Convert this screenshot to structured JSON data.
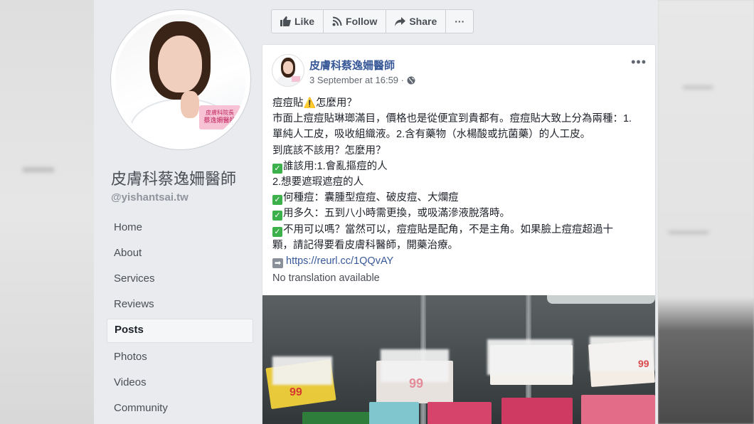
{
  "page": {
    "name": "皮膚科蔡逸姍醫師",
    "handle": "@yishantsai.tw",
    "avatar_badge_lines": [
      "皮膚科院長",
      "蔡逸姍醫師"
    ]
  },
  "nav": {
    "items": [
      {
        "label": "Home",
        "active": false
      },
      {
        "label": "About",
        "active": false
      },
      {
        "label": "Services",
        "active": false
      },
      {
        "label": "Reviews",
        "active": false
      },
      {
        "label": "Posts",
        "active": true
      },
      {
        "label": "Photos",
        "active": false
      },
      {
        "label": "Videos",
        "active": false
      },
      {
        "label": "Community",
        "active": false
      }
    ]
  },
  "actions": {
    "like": "Like",
    "follow": "Follow",
    "share": "Share",
    "more": "···"
  },
  "post": {
    "author": "皮膚科蔡逸姍醫師",
    "timestamp": "3 September at 16:59 ·",
    "more": "•••",
    "lines": [
      {
        "prefix": "",
        "text": "痘痘貼",
        "warn": "⚠️",
        "after": "怎麼用？"
      },
      {
        "prefix": "",
        "text": "市面上痘痘貼琳瑯滿目，價格也是從便宜到貴都有。痘痘貼大致上分為兩種：1."
      },
      {
        "prefix": "",
        "text": "單純人工皮，吸收組織液。2.含有藥物（水楊酸或抗菌藥）的人工皮。"
      },
      {
        "prefix": "",
        "text": "到底該不該用？怎麼用？"
      },
      {
        "prefix": "check",
        "text": "誰該用:1.會亂摳痘的人"
      },
      {
        "prefix": "",
        "text": "2.想要遮瑕遮痘的人"
      },
      {
        "prefix": "check",
        "text": "何種痘：囊腫型痘痘、破皮痘、大爛痘"
      },
      {
        "prefix": "check",
        "text": "用多久：五到八小時需更換，或吸滿滲液脫落時。"
      },
      {
        "prefix": "check",
        "text": "不用可以嗎？當然可以，痘痘貼是配角，不是主角。如果臉上痘痘超過十"
      },
      {
        "prefix": "",
        "text": "顆，請記得要看皮膚科醫師，開藥治療。"
      }
    ],
    "link": "https://reurl.cc/1QQvAY",
    "translation_note": "No translation available",
    "image_tags": [
      "99",
      "99",
      "99"
    ]
  },
  "colors": {
    "link": "#385898",
    "check": "#3cb04a",
    "frame_bg": "#e9ebee"
  }
}
